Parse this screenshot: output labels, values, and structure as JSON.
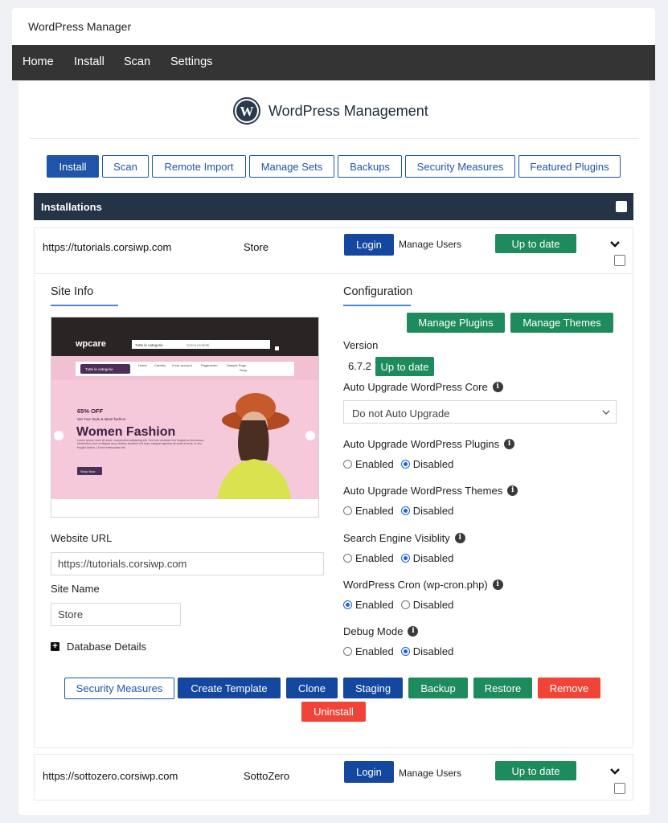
{
  "app": {
    "title": "WordPress Manager"
  },
  "nav": {
    "items": [
      "Home",
      "Install",
      "Scan",
      "Settings"
    ]
  },
  "brand": {
    "title": "WordPress Management"
  },
  "tabs": [
    "Install",
    "Scan",
    "Remote Import",
    "Manage Sets",
    "Backups",
    "Security Measures",
    "Featured Plugins"
  ],
  "installations": {
    "header": "Installations",
    "rows": [
      {
        "url": "https://tutorials.corsiwp.com",
        "name": "Store",
        "login": "Login",
        "manage_users": "Manage Users",
        "status": "Up to date"
      },
      {
        "url": "https://sottozero.corsiwp.com",
        "name": "SottoZero",
        "login": "Login",
        "manage_users": "Manage Users",
        "status": "Up to date"
      }
    ]
  },
  "site_info": {
    "title": "Site Info",
    "website_url_label": "Website URL",
    "website_url": "https://tutorials.corsiwp.com",
    "site_name_label": "Site Name",
    "site_name": "Store",
    "db_details": "Database Details"
  },
  "preview": {
    "logo": "wpcare",
    "search_category": "Tutte le categorie",
    "search_placeholder": "Cerca prodotti",
    "menu_category": "Tutte le categorie",
    "menu": [
      "Home",
      "Carrello",
      "Il mio account",
      "Pagamento",
      "Sample Page",
      "Shop"
    ],
    "offer": "65% OFF",
    "tagline": "Set Your Style & latest fashion",
    "headline": "Women Fashion",
    "body": "Lorem ipsum dolor sit amet, consectetur adipiscing elit. Sed non molestie nec feugiat eu dui cursus, elementum sem ut aliquet urna, finibus tincidunt elit dolor volutpat egestas sit amet et eros, in nisl feugiat lacinia. Ut sed malesuada nisi.",
    "cta": "Shop Now"
  },
  "config": {
    "title": "Configuration",
    "manage_plugins": "Manage Plugins",
    "manage_themes": "Manage Themes",
    "version_label": "Version",
    "version": "6.7.2",
    "version_status": "Up to date",
    "auto_core_label": "Auto Upgrade WordPress Core",
    "auto_core_value": "Do not Auto Upgrade",
    "enabled": "Enabled",
    "disabled": "Disabled",
    "settings": [
      {
        "label": "Auto Upgrade WordPress Plugins",
        "value": "Disabled"
      },
      {
        "label": "Auto Upgrade WordPress Themes",
        "value": "Disabled"
      },
      {
        "label": "Search Engine Visiblity",
        "value": "Disabled"
      },
      {
        "label": "WordPress Cron (wp-cron.php)",
        "value": "Enabled"
      },
      {
        "label": "Debug Mode",
        "value": "Disabled"
      }
    ]
  },
  "actions": [
    "Security Measures",
    "Create Template",
    "Clone",
    "Staging",
    "Backup",
    "Restore",
    "Remove",
    "Uninstall"
  ],
  "colors": {
    "primary": "#1447a0",
    "success": "#1d8b5c",
    "danger": "#f04438",
    "header": "#243346",
    "nav": "#343434"
  }
}
